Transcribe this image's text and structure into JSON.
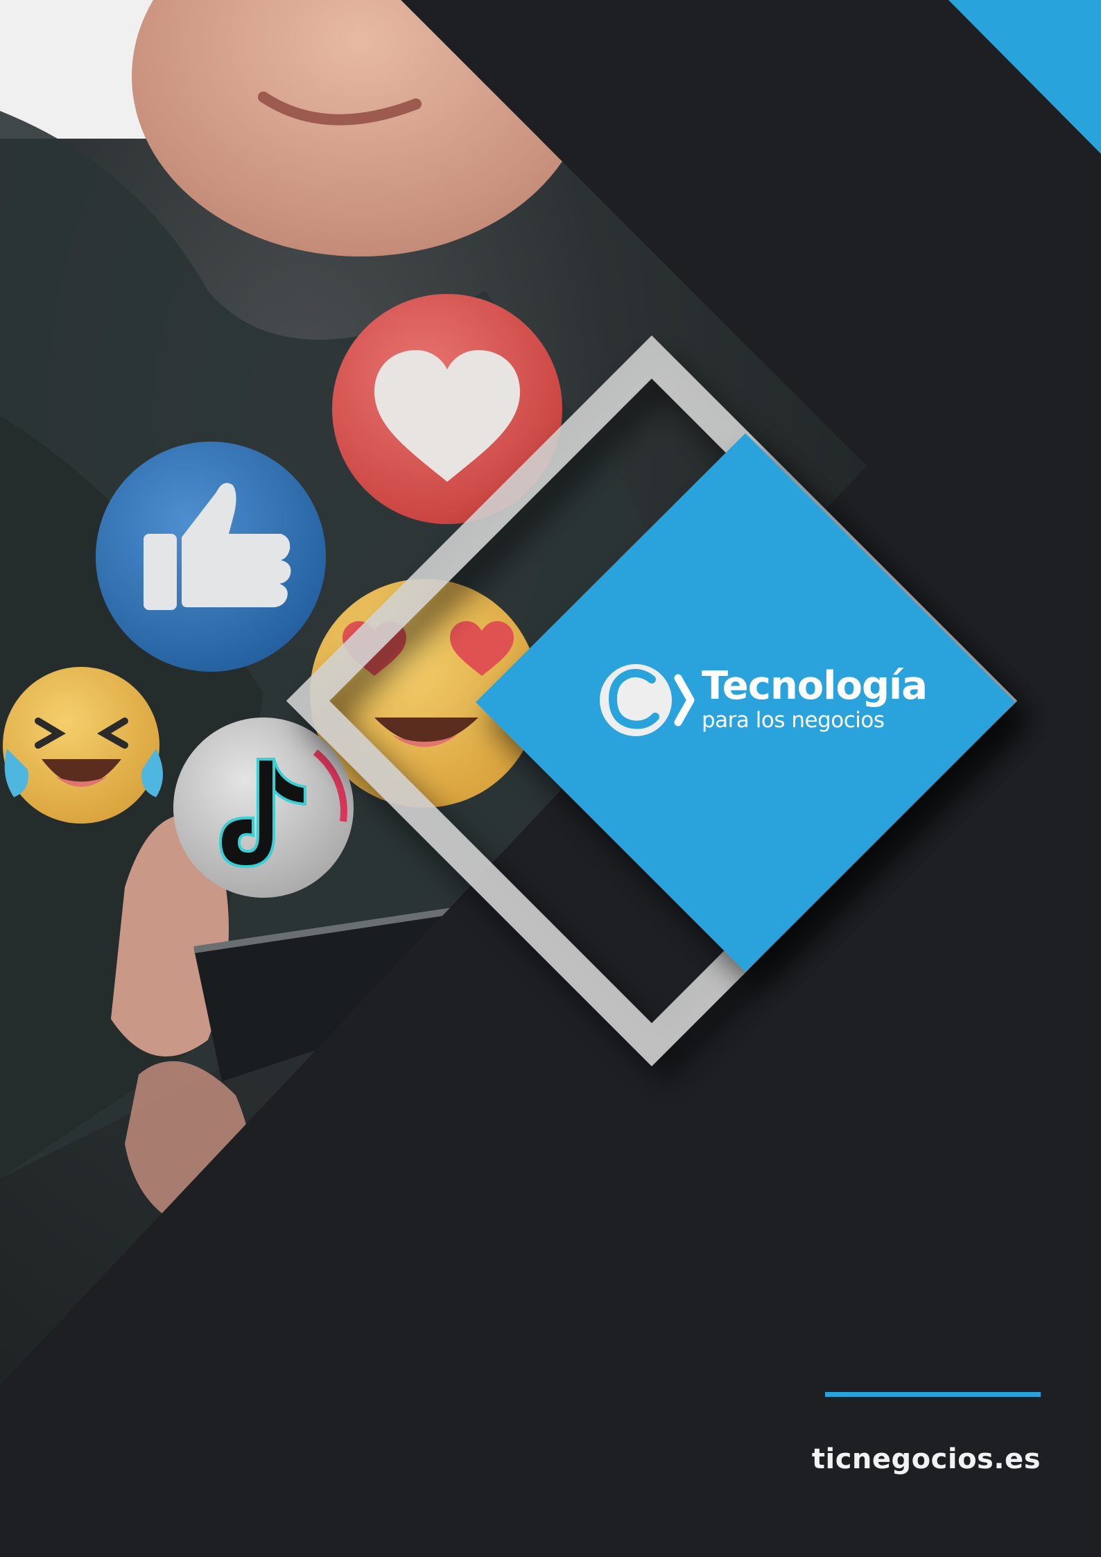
{
  "brand": {
    "name": "Tecnología",
    "tagline": "para los negocios",
    "logo_letter": "c"
  },
  "footer": {
    "url": "ticnegocios.es"
  },
  "icons": [
    "heart-reaction-icon",
    "thumbs-up-reaction-icon",
    "heart-eyes-emoji-icon",
    "laughing-tears-emoji-icon",
    "tiktok-logo-icon"
  ],
  "colors": {
    "background": "#1d1f23",
    "accent_blue": "#29a3dc",
    "frame_gray": "#d4d4d4",
    "heart_red": "#d9534f",
    "like_blue": "#2f6fb0",
    "emoji_yellow": "#e8b54a"
  }
}
